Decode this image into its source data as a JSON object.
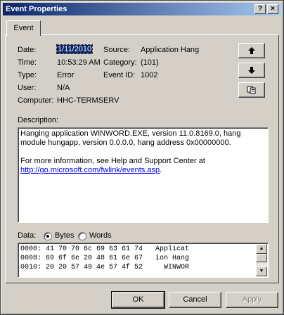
{
  "window": {
    "title": "Event Properties",
    "help_button": "?",
    "close_button": "×"
  },
  "tabs": [
    {
      "label": "Event"
    }
  ],
  "fields": {
    "date_label": "Date:",
    "date_value": "1/11/2010",
    "time_label": "Time:",
    "time_value": "10:53:29 AM",
    "type_label": "Type:",
    "type_value": "Error",
    "user_label": "User:",
    "user_value": "N/A",
    "computer_label": "Computer:",
    "computer_value": "HHC-TERMSERV",
    "source_label": "Source:",
    "source_value": "Application Hang",
    "category_label": "Category:",
    "category_value": "(101)",
    "eventid_label": "Event ID:",
    "eventid_value": "1002"
  },
  "nav_buttons": {
    "up_icon": "arrow-up-icon",
    "down_icon": "arrow-down-icon",
    "copy_icon": "copy-icon"
  },
  "description": {
    "label": "Description:",
    "line1": "Hanging application WINWORD.EXE, version 11.0.8169.0, hang module hungapp, version 0.0.0.0, hang address 0x00000000.",
    "line2": "For more information, see Help and Support Center at",
    "link": "http://go.microsoft.com/fwlink/events.asp",
    "after_link": "."
  },
  "data_section": {
    "label": "Data:",
    "bytes_label": "Bytes",
    "words_label": "Words",
    "selected": "Bytes",
    "rows": [
      "0000: 41 70 70 6c 69 63 61 74   Applicat",
      "0008: 69 6f 6e 20 48 61 6e 67   ion Hang",
      "0010: 20 20 57 49 4e 57 4f 52     WINWOR"
    ]
  },
  "buttons": {
    "ok": "OK",
    "cancel": "Cancel",
    "apply": "Apply"
  },
  "colors": {
    "face": "#d4d0c8",
    "title_start": "#0a246a",
    "title_end": "#a6caf0",
    "link": "#0000ee"
  }
}
